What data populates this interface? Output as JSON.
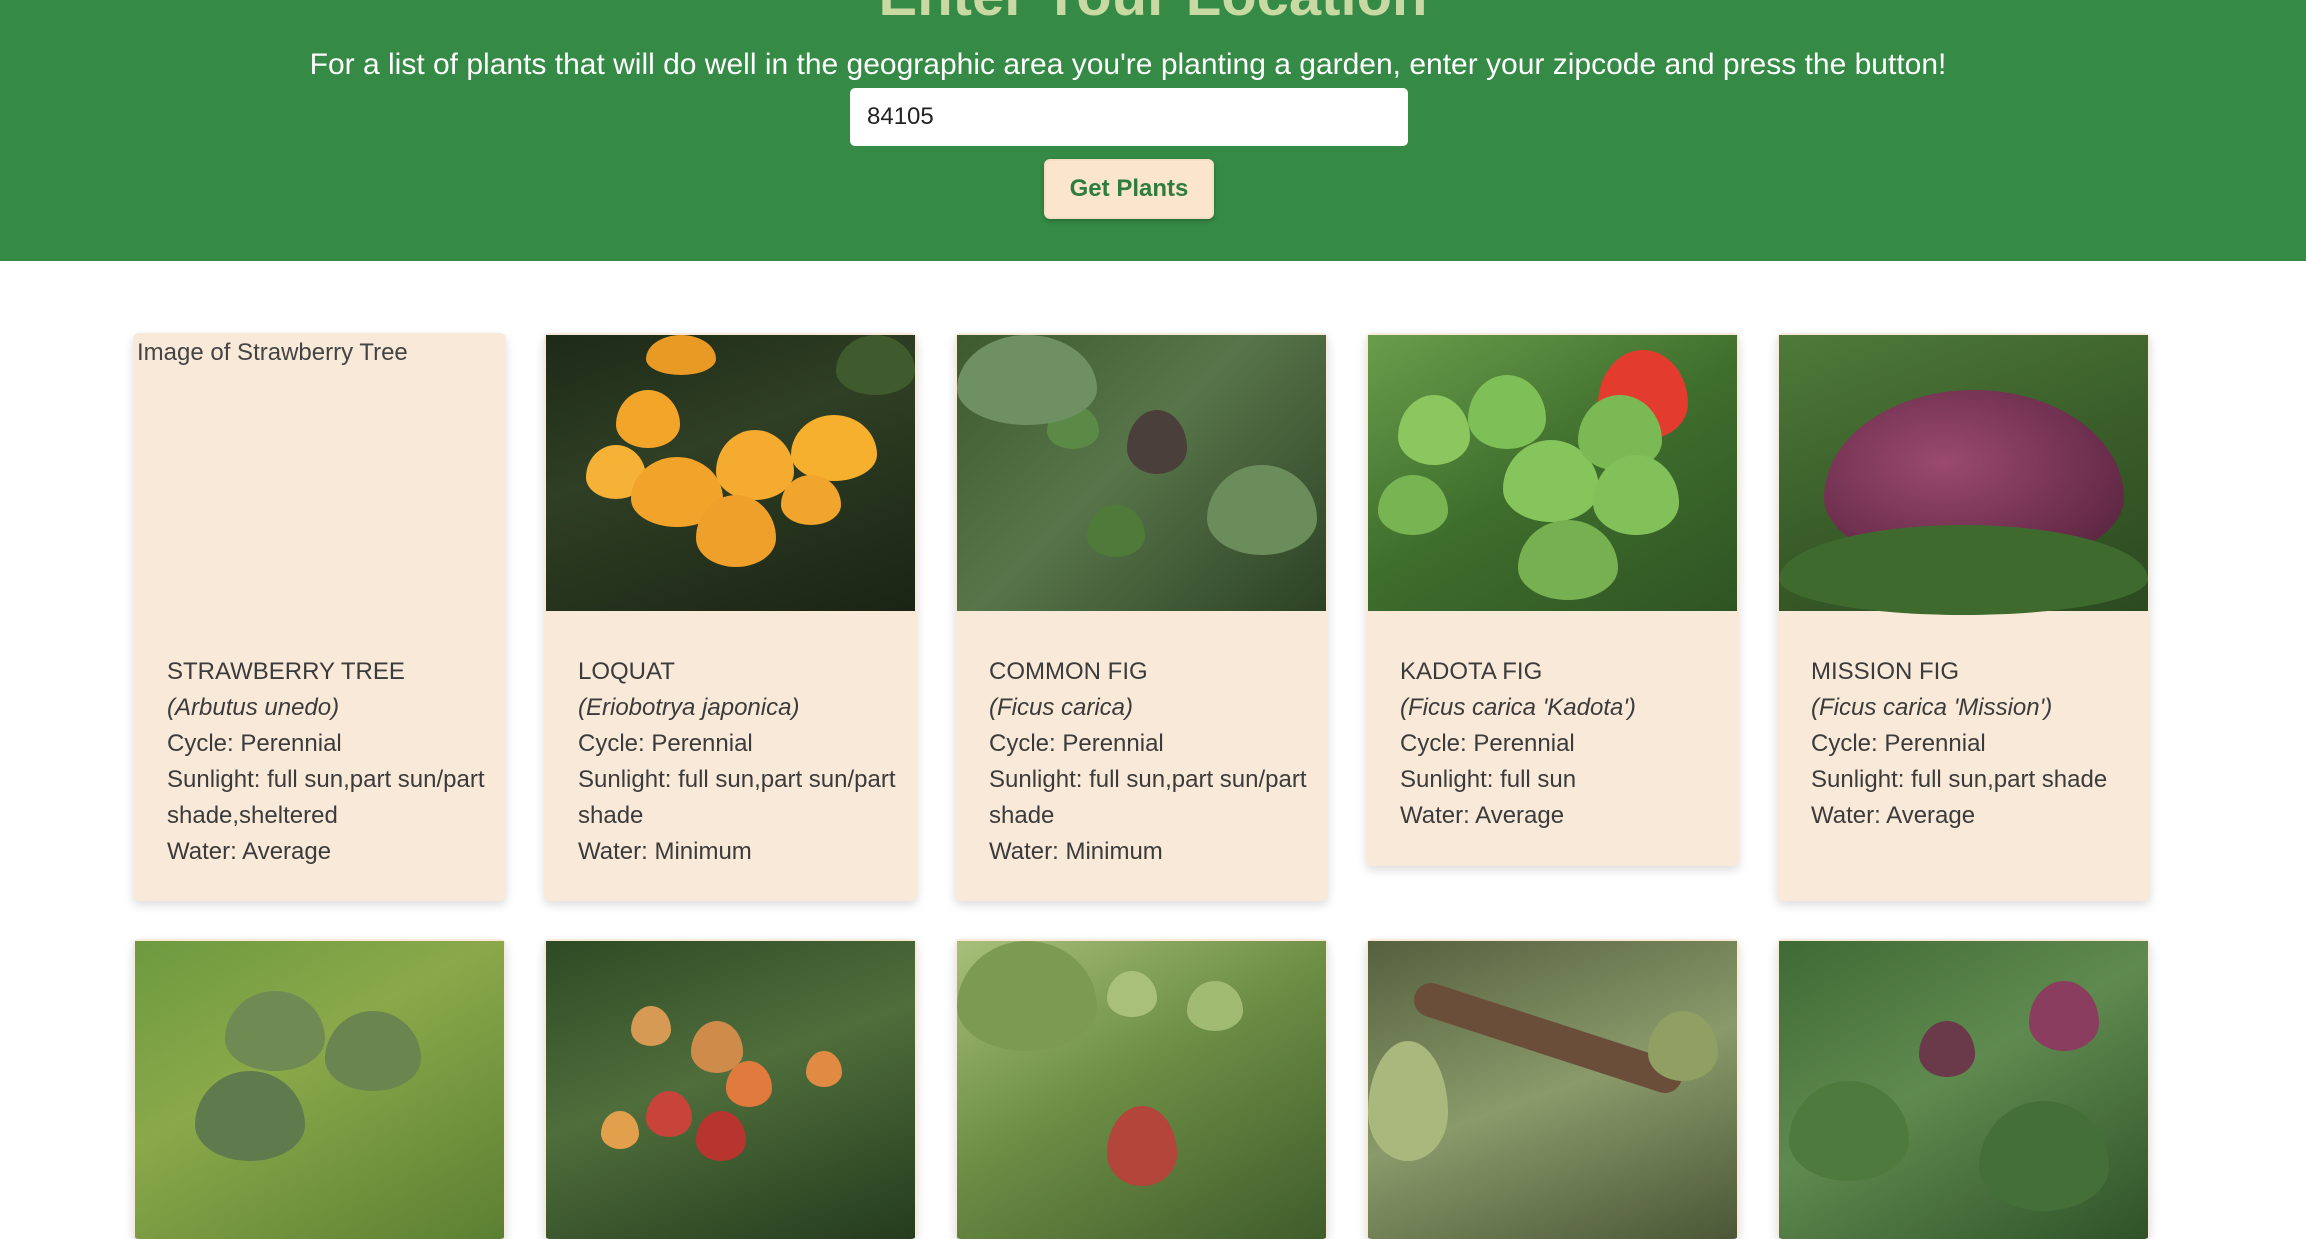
{
  "header": {
    "title": "Enter Your Location",
    "subtitle": "For a list of plants that will do well in the geographic area you're planting a garden, enter your zipcode and press the button!",
    "zip_value": "84105",
    "button_label": "Get Plants"
  },
  "plants": [
    {
      "name": "STRAWBERRY TREE",
      "scientific": "(Arbutus unedo)",
      "cycle": "Cycle: Perennial",
      "sunlight": "Sunlight: full sun,part sun/part shade,sheltered",
      "water": "Water: Average",
      "image_alt": "Image of Strawberry Tree"
    },
    {
      "name": "LOQUAT",
      "scientific": "(Eriobotrya japonica)",
      "cycle": "Cycle: Perennial",
      "sunlight": "Sunlight: full sun,part sun/part shade",
      "water": "Water: Minimum"
    },
    {
      "name": "COMMON FIG",
      "scientific": "(Ficus carica)",
      "cycle": "Cycle: Perennial",
      "sunlight": "Sunlight: full sun,part sun/part shade",
      "water": "Water: Minimum"
    },
    {
      "name": "KADOTA FIG",
      "scientific": "(Ficus carica 'Kadota')",
      "cycle": "Cycle: Perennial",
      "sunlight": "Sunlight: full sun",
      "water": "Water: Average"
    },
    {
      "name": "MISSION FIG",
      "scientific": "(Ficus carica 'Mission')",
      "cycle": "Cycle: Perennial",
      "sunlight": "Sunlight: full sun,part shade",
      "water": "Water: Average"
    }
  ],
  "colors": {
    "header_bg": "#358a45",
    "card_bg": "#f9e9d8",
    "button_bg": "#fbe5cc",
    "button_text": "#2e7d3f"
  }
}
